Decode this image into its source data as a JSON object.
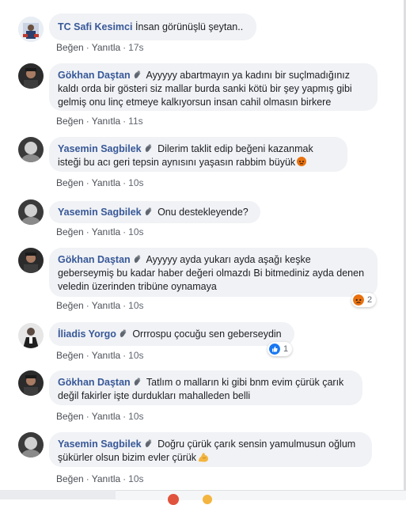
{
  "comments": [
    {
      "author": "TC Safi Kesimci",
      "text": "İnsan görünüşlü şeytan..",
      "like_label": "Beğen",
      "reply_label": "Yanıtla",
      "time": "17s"
    },
    {
      "author": "Gökhan Daştan",
      "text": " Ayyyyy abartmayın ya kadını bir suçlmadığınız kaldı orda bir gösteri siz mallar burda sanki kötü bir şey yapmış gibi gelmiş onu linç etmeye kalkıyorsun insan cahil olmasın birkere",
      "like_label": "Beğen",
      "reply_label": "Yanıtla",
      "time": "11s"
    },
    {
      "author": "Yasemin Sagbilek",
      "text": " Dilerim taklit edip beğeni kazanmak isteği bu acı geri tepsin aynısını yaşasın rabbim büyük",
      "like_label": "Beğen",
      "reply_label": "Yanıtla",
      "time": "10s"
    },
    {
      "author": "Yasemin Sagbilek",
      "text": " Onu destekleyende?",
      "like_label": "Beğen",
      "reply_label": "Yanıtla",
      "time": "10s"
    },
    {
      "author": "Gökhan Daştan",
      "text": " Ayyyyy ayda yukarı ayda aşağı keşke geberseymiş bu kadar haber değeri olmazdı Bi bitmediniz ayda denen veledin üzerinden tribüne oynamaya",
      "like_label": "Beğen",
      "reply_label": "Yanıtla",
      "time": "10s",
      "reaction": {
        "type": "angry",
        "count": "2"
      }
    },
    {
      "author": "İliadis Yorgo",
      "text": " Orrrospu çocuğu sen geberseydin",
      "like_label": "Beğen",
      "reply_label": "Yanıtla",
      "time": "10s",
      "reaction": {
        "type": "like",
        "count": "1"
      }
    },
    {
      "author": "Gökhan Daştan",
      "text": " Tatlım o malların ki gibi bnm evim çürük çarık değil fakirler işte durdukları mahalleden belli",
      "like_label": "Beğen",
      "reply_label": "Yanıtla",
      "time": "10s"
    },
    {
      "author": "Yasemin Sagbilek",
      "text": " Doğru çürük çarık sensin yamulmusun oğlum şükürler olsun bizim evler çürük",
      "like_label": "Beğen",
      "reply_label": "Yanıtla",
      "time": "10s"
    }
  ],
  "icons": {
    "wave": "waving-hand-icon",
    "angry": "angry-face-icon",
    "flex": "flexed-biceps-icon",
    "like": "thumbs-up-icon"
  },
  "colors": {
    "author": "#385898",
    "bubble": "#f0f2f5",
    "meta": "#606770",
    "like_blue": "#1877f2",
    "angry": "#e9710f"
  },
  "separator": "·"
}
